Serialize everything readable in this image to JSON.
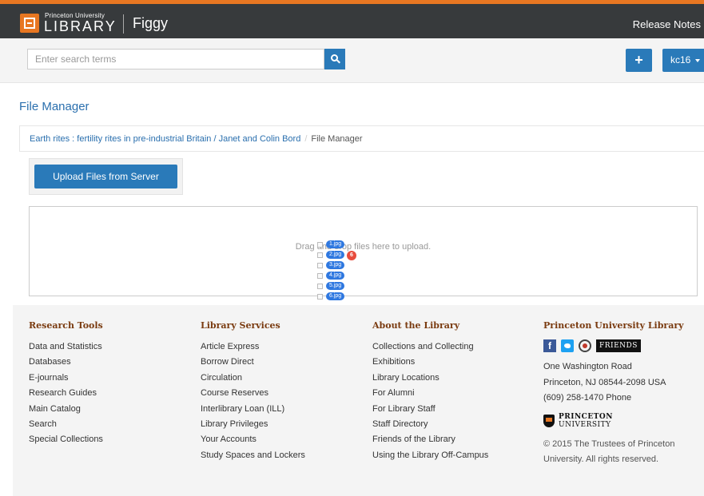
{
  "header": {
    "logo_small": "Princeton University",
    "logo_big": "LIBRARY",
    "app_name": "Figgy",
    "release_notes": "Release Notes"
  },
  "search": {
    "placeholder": "Enter search terms",
    "value": ""
  },
  "toolbar": {
    "add_label": "+",
    "user_label": "kc16"
  },
  "main": {
    "title": "File Manager",
    "breadcrumb": {
      "link": "Earth rites : fertility rites in pre-industrial Britain / Janet and Colin Bord",
      "separator": "/",
      "current": "File Manager"
    },
    "upload_button": "Upload Files from Server",
    "drop_text": "Drag and drop files here to upload."
  },
  "drag_ghost": {
    "files": [
      "1.jpg",
      "2.jpg",
      "3.jpg",
      "4.jpg",
      "5.jpg",
      "6.jpg"
    ],
    "count": "6"
  },
  "footer": {
    "research_tools": {
      "title": "Research Tools",
      "items": [
        "Data and Statistics",
        "Databases",
        "E-journals",
        "Research Guides",
        "Main Catalog",
        "Search",
        "Special Collections"
      ]
    },
    "library_services": {
      "title": "Library Services",
      "items": [
        "Article Express",
        "Borrow Direct",
        "Circulation",
        "Course Reserves",
        "Interlibrary Loan (ILL)",
        "Library Privileges",
        "Your Accounts",
        "Study Spaces and Lockers"
      ]
    },
    "about": {
      "title": "About the Library",
      "items": [
        "Collections and Collecting",
        "Exhibitions",
        "Library Locations",
        "For Alumni",
        "For Library Staff",
        "Staff Directory",
        "Friends of the Library",
        "Using the Library Off-Campus"
      ]
    },
    "pul": {
      "title": "Princeton University Library",
      "friends": "FRIENDS",
      "address1": "One Washington Road",
      "address2": "Princeton, NJ 08544-2098 USA",
      "phone": "(609) 258-1470 Phone",
      "pu_line1": "PRINCETON",
      "pu_line2": "UNIVERSITY",
      "copyright1": "© 2015 The Trustees of Princeton",
      "copyright2": "University. All rights reserved."
    }
  },
  "colors": {
    "accent_orange": "#e87722",
    "primary_blue": "#2a7ab9",
    "header_dark": "#373a3c",
    "badge_red": "#e84c3d"
  }
}
